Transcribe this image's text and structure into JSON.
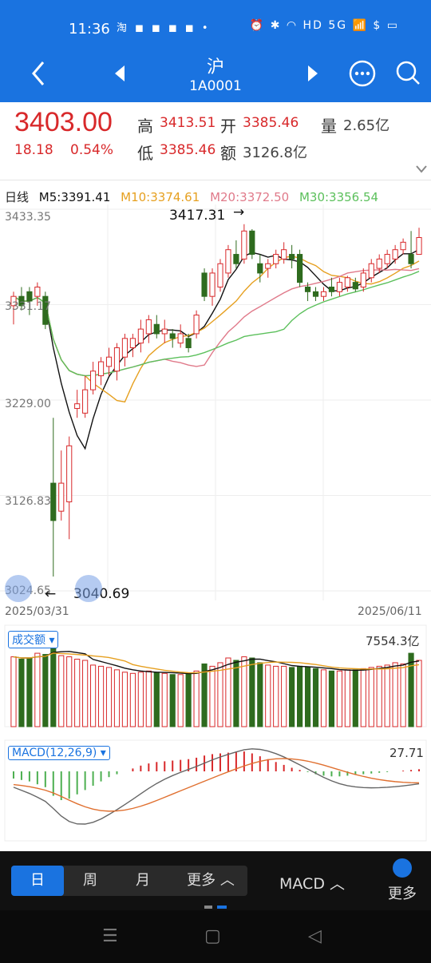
{
  "status": {
    "time": "11:36",
    "left_icons": "淘 ◼ ◼ ◼ ◼ •",
    "right_icons": "⏰ ✱ ◠ HD 5G 📶 $ ▭"
  },
  "nav": {
    "title": "沪",
    "subtitle": "1A0001"
  },
  "quote": {
    "price": "3403.00",
    "change": "18.18",
    "change_pct": "0.54%",
    "high_label": "高",
    "high": "3413.51",
    "open_label": "开",
    "open": "3385.46",
    "vol_label": "量",
    "vol": "2.65亿",
    "low_label": "低",
    "low": "3385.46",
    "amt_label": "额",
    "amt": "3126.8亿"
  },
  "ma": {
    "period": "日线",
    "m5": "M5:3391.41",
    "m10": "M10:3374.61",
    "m20": "M20:3372.50",
    "m30": "M30:3356.54"
  },
  "colors": {
    "up": "#d8282a",
    "down": "#2e6b1e",
    "m5": "#111111",
    "m10": "#e6a020",
    "m20": "#e07a8a",
    "m30": "#5cc05c",
    "brand": "#1a73e0"
  },
  "kchart": {
    "y_labels": [
      "3433.35",
      "3331.17",
      "3229.00",
      "3126.83",
      "3024.65"
    ],
    "high_mark": "3417.31",
    "low_mark": "3040.69",
    "date_start": "2025/03/31",
    "date_end": "2025/06/11"
  },
  "volume": {
    "label": "成交额",
    "max_label": "7554.3亿"
  },
  "macd": {
    "label": "MACD(12,26,9)",
    "max_label": "27.71"
  },
  "bottom": {
    "tabs": [
      "日",
      "周",
      "月",
      "更多"
    ],
    "indicator": "MACD",
    "more": "更多"
  },
  "chart_data": {
    "type": "candlestick",
    "candles": [
      [
        3330,
        3340,
        3310,
        3345
      ],
      [
        3340,
        3330,
        3325,
        3350
      ],
      [
        3345,
        3335,
        3320,
        3350
      ],
      [
        3340,
        3350,
        3330,
        3355
      ],
      [
        3340,
        3310,
        3305,
        3345
      ],
      [
        3140,
        3100,
        3040,
        3210
      ],
      [
        3110,
        3140,
        3100,
        3175
      ],
      [
        3120,
        3180,
        3080,
        3190
      ],
      [
        3220,
        3225,
        3210,
        3240
      ],
      [
        3215,
        3240,
        3210,
        3255
      ],
      [
        3240,
        3260,
        3235,
        3270
      ],
      [
        3255,
        3270,
        3245,
        3275
      ],
      [
        3265,
        3275,
        3255,
        3285
      ],
      [
        3260,
        3285,
        3250,
        3290
      ],
      [
        3275,
        3295,
        3265,
        3300
      ],
      [
        3285,
        3295,
        3275,
        3300
      ],
      [
        3290,
        3305,
        3280,
        3315
      ],
      [
        3300,
        3315,
        3290,
        3320
      ],
      [
        3310,
        3300,
        3295,
        3320
      ],
      [
        3300,
        3305,
        3290,
        3315
      ],
      [
        3300,
        3295,
        3285,
        3305
      ],
      [
        3290,
        3300,
        3285,
        3310
      ],
      [
        3295,
        3285,
        3280,
        3300
      ],
      [
        3300,
        3320,
        3295,
        3325
      ],
      [
        3365,
        3340,
        3335,
        3370
      ],
      [
        3340,
        3365,
        3330,
        3370
      ],
      [
        3350,
        3375,
        3345,
        3380
      ],
      [
        3365,
        3390,
        3360,
        3395
      ],
      [
        3385,
        3375,
        3370,
        3400
      ],
      [
        3380,
        3410,
        3375,
        3417.31
      ],
      [
        3410,
        3385,
        3380,
        3412
      ],
      [
        3375,
        3365,
        3355,
        3385
      ],
      [
        3370,
        3375,
        3360,
        3380
      ],
      [
        3375,
        3385,
        3370,
        3390
      ],
      [
        3380,
        3390,
        3375,
        3398
      ],
      [
        3385,
        3380,
        3370,
        3395
      ],
      [
        3385,
        3355,
        3350,
        3390
      ],
      [
        3350,
        3345,
        3335,
        3355
      ],
      [
        3345,
        3340,
        3335,
        3350
      ],
      [
        3340,
        3345,
        3335,
        3350
      ],
      [
        3350,
        3345,
        3340,
        3360
      ],
      [
        3345,
        3355,
        3340,
        3360
      ],
      [
        3350,
        3360,
        3345,
        3362
      ],
      [
        3355,
        3348,
        3345,
        3360
      ],
      [
        3350,
        3365,
        3345,
        3370
      ],
      [
        3360,
        3375,
        3355,
        3380
      ],
      [
        3370,
        3380,
        3365,
        3385
      ],
      [
        3375,
        3385,
        3370,
        3390
      ],
      [
        3380,
        3390,
        3375,
        3395
      ],
      [
        3390,
        3398,
        3385,
        3402
      ],
      [
        3385,
        3375,
        3370,
        3410
      ],
      [
        3385,
        3403,
        3385.46,
        3413.51
      ]
    ],
    "volume": [
      5900,
      5700,
      5800,
      6200,
      6100,
      7554.3,
      6000,
      5900,
      5700,
      5600,
      5200,
      5100,
      5000,
      4800,
      4600,
      4500,
      4600,
      4700,
      4600,
      4500,
      4400,
      4400,
      4500,
      4700,
      5300,
      5100,
      5400,
      5800,
      5600,
      5900,
      5800,
      5400,
      5200,
      5100,
      5100,
      5000,
      5100,
      5000,
      4900,
      4800,
      4700,
      4700,
      4800,
      4800,
      4900,
      5000,
      5100,
      5200,
      5400,
      5300,
      6200,
      5600
    ],
    "macd_bars": [
      -10,
      -12,
      -14,
      -18,
      -22,
      -34,
      -40,
      -38,
      -32,
      -26,
      -20,
      -14,
      -8,
      -4,
      0,
      4,
      8,
      11,
      13,
      14,
      15,
      16,
      17,
      19,
      22,
      24,
      25,
      26,
      27,
      27.71,
      25,
      21,
      17,
      13,
      9,
      5,
      2,
      -1,
      -4,
      -6,
      -7,
      -7,
      -6,
      -5,
      -4,
      -3,
      -2,
      -1,
      0,
      1,
      2,
      3
    ],
    "ylim": [
      3024.65,
      3433.35
    ]
  }
}
